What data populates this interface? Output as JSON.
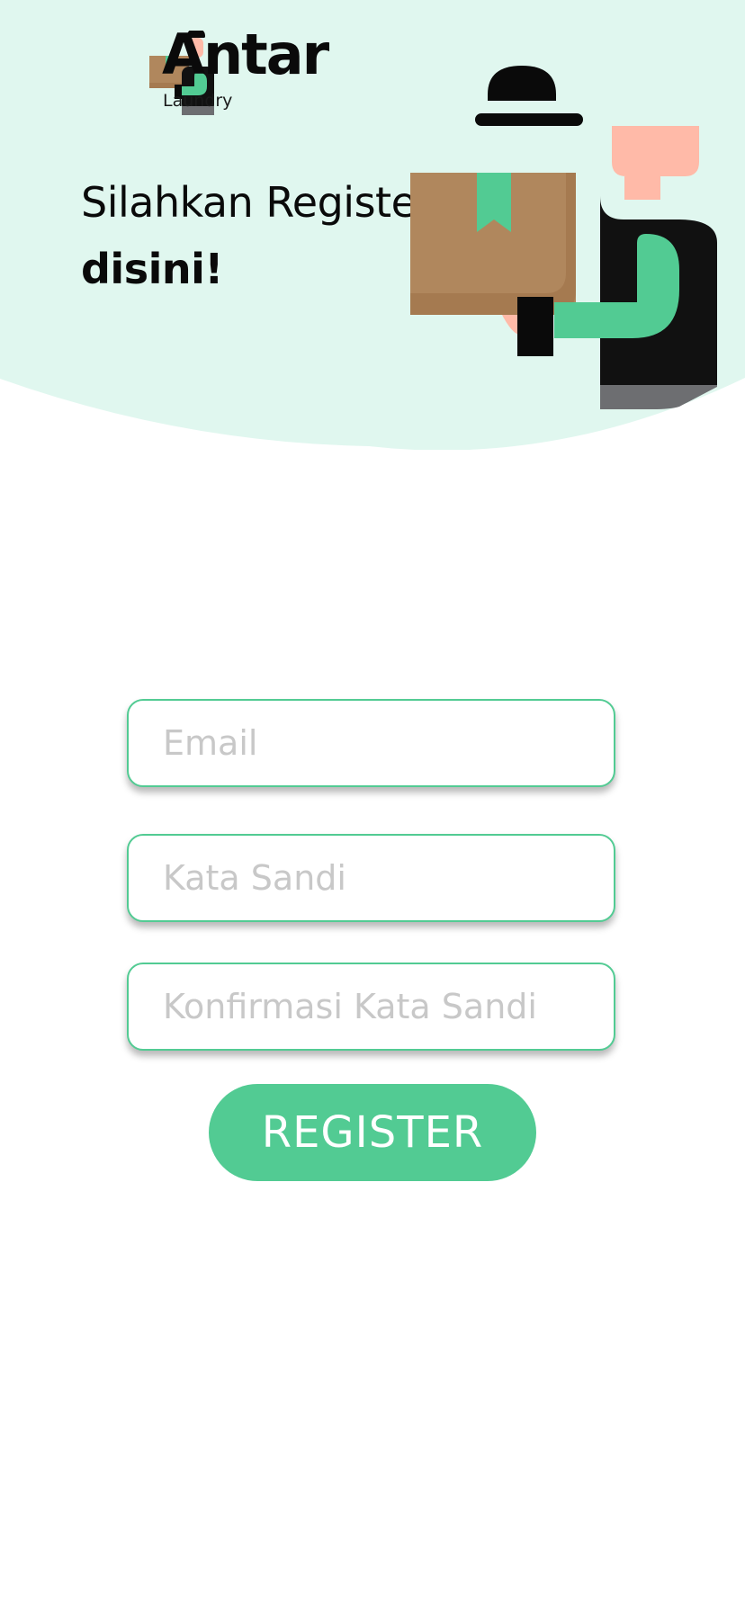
{
  "brand": {
    "name": "Antar",
    "subtitle": "Laundry"
  },
  "headline": {
    "line1": "Silahkan Register,",
    "line2": "disini!"
  },
  "form": {
    "email_placeholder": "Email",
    "password_placeholder": "Kata Sandi",
    "confirm_password_placeholder": "Konfirmasi Kata Sandi",
    "submit_label": "REGISTER"
  },
  "colors": {
    "accent": "#52cb93",
    "header_background": "#e0f7ef",
    "placeholder": "#c8c8c8",
    "box_brown": "#b0875d"
  },
  "icons": {
    "logo": "courier-with-box-icon",
    "illustration": "courier-holding-package-illustration"
  }
}
